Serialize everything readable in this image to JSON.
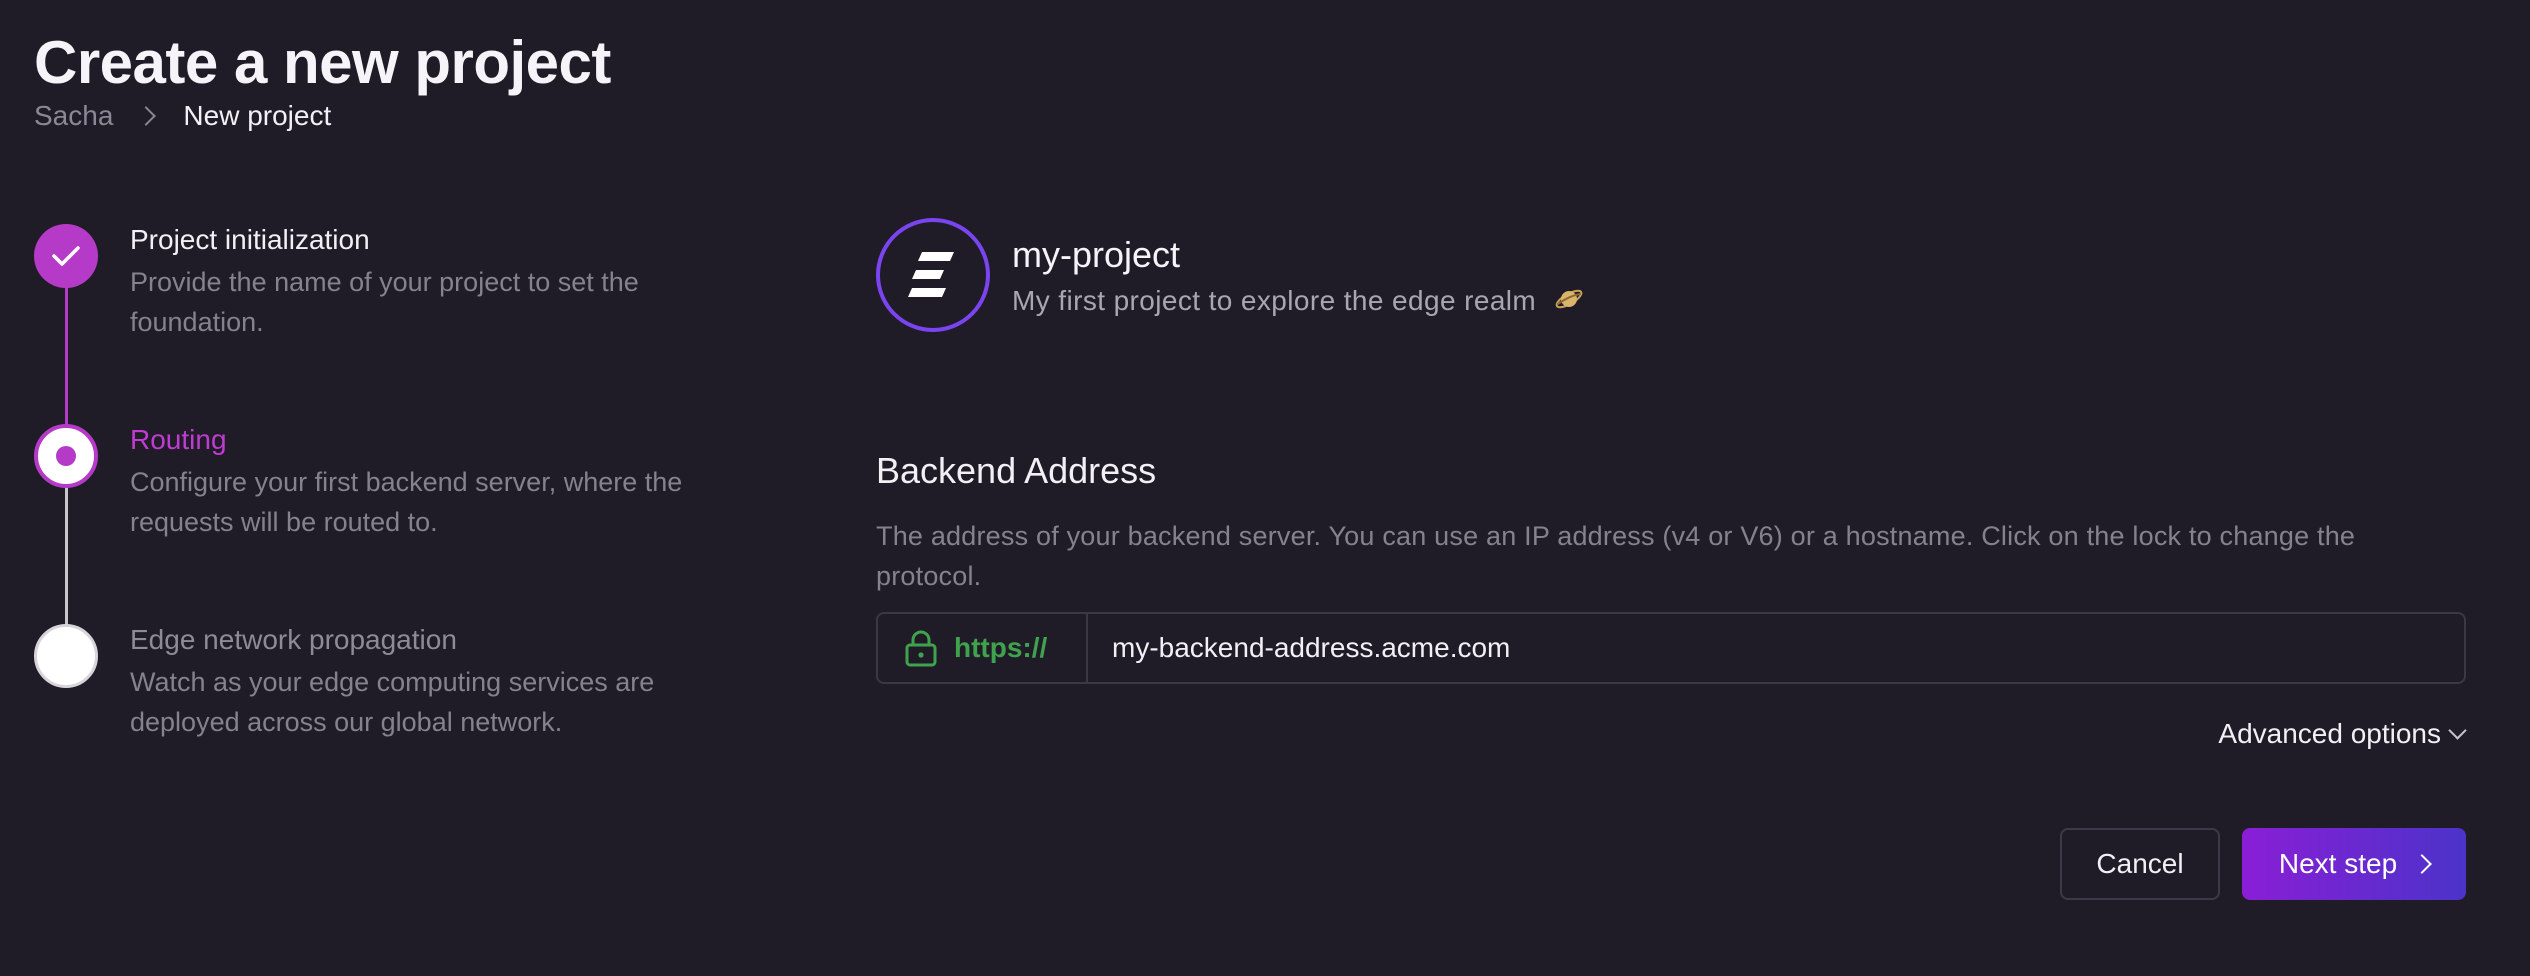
{
  "page": {
    "title": "Create a new project"
  },
  "breadcrumb": {
    "root": "Sacha",
    "current": "New project"
  },
  "stepper": {
    "steps": [
      {
        "title": "Project initialization",
        "description": "Provide the name of your project to set the foundation.",
        "state": "completed"
      },
      {
        "title": "Routing",
        "description": "Configure your first backend server, where the requests will be routed to.",
        "state": "current"
      },
      {
        "title": "Edge network propagation",
        "description": "Watch as your edge computing services are deployed across our global network.",
        "state": "pending"
      }
    ]
  },
  "project": {
    "name": "my-project",
    "description": "My first project to explore the edge realm",
    "logo_icon": "edge-logo-icon",
    "emoji_icon": "planet-icon"
  },
  "backend": {
    "title": "Backend Address",
    "description": "The address of your backend server. You can use an IP address (v4 or V6) or a hostname. Click on the lock to change the protocol.",
    "protocol": "https://",
    "address_value": "my-backend-address.acme.com",
    "lock_icon": "lock-icon"
  },
  "advanced_options": {
    "label": "Advanced options"
  },
  "actions": {
    "cancel_label": "Cancel",
    "next_label": "Next step"
  },
  "colors": {
    "background": "#201c27",
    "accent": "#b63ac8",
    "protocol_green": "#3fa34d",
    "button_gradient_start": "#8a1ed6",
    "button_gradient_end": "#4b33c9"
  }
}
